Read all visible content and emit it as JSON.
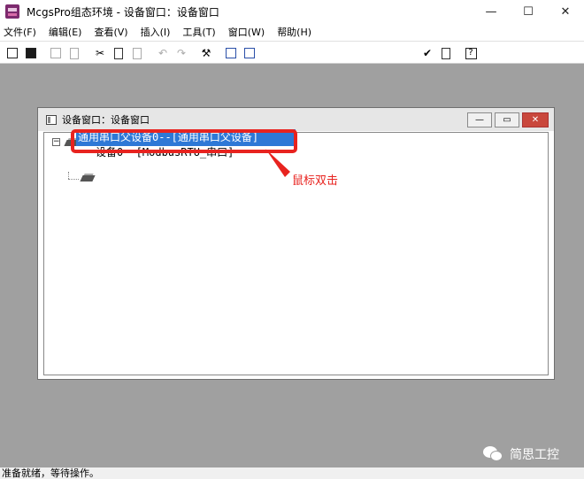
{
  "window": {
    "title": "McgsPro组态环境 - 设备窗口：设备窗口",
    "minimize_glyph": "—",
    "maximize_glyph": "☐",
    "close_glyph": "✕"
  },
  "menu": [
    "文件(F)",
    "编辑(E)",
    "查看(V)",
    "插入(I)",
    "工具(T)",
    "窗口(W)",
    "帮助(H)"
  ],
  "toolbar": {
    "cut_glyph": "✂",
    "undo_glyph": "↶",
    "redo_glyph": "↷",
    "tools_glyph": "⚒",
    "check_glyph": "✔",
    "help_glyph": "?"
  },
  "child_window": {
    "title": "设备窗口：设备窗口",
    "min_glyph": "—",
    "max_glyph": "▭",
    "close_glyph": "✕"
  },
  "tree": {
    "root_label": "通用串口父设备0--[通用串口父设备]",
    "root_expander": "−",
    "child_label": "设备0--[ModbusRTU_串口]"
  },
  "annotation": {
    "text": "鼠标双击",
    "color": "#e8231f"
  },
  "watermark": "简思工控",
  "status": "准备就绪，等待操作。",
  "colors": {
    "selection": "#2e78d6",
    "workspace": "#a0a0a0",
    "close_button": "#c9473c"
  }
}
